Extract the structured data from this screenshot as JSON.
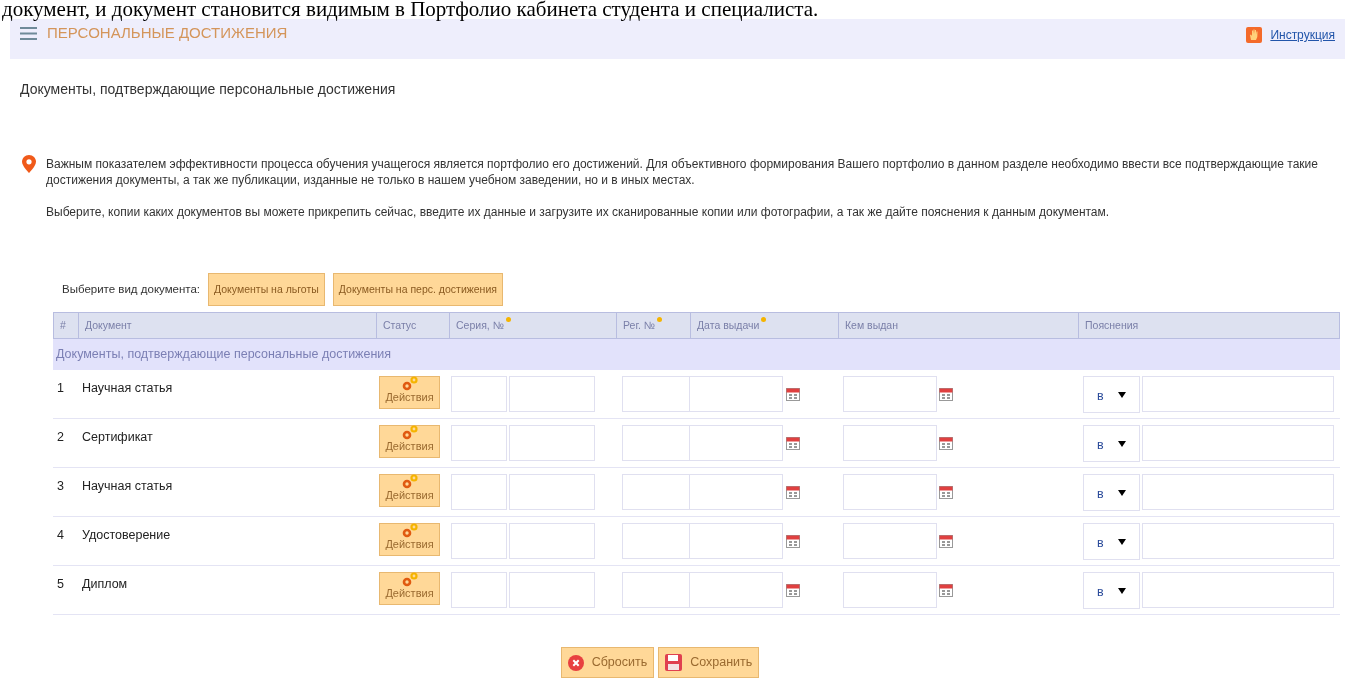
{
  "document_caption": "документ, и документ становится видимым в Портфолио кабинета студента и специалиста.",
  "header": {
    "title": "ПЕРСОНАЛЬНЫЕ ДОСТИЖЕНИЯ",
    "help_link": "Инструкция"
  },
  "page_title": "Документы, подтверждающие персональные достижения",
  "info": [
    "Важным показателем эффективности процесса обучения учащегося является портфолио его достижений. Для объективного формирования Вашего портфолио в данном разделе необходимо ввести все подтверждающие такие достижения документы, а так же публикации, изданные не только в нашем учебном заведении, но и в иных местах.",
    "Выберите, копии каких документов вы можете прикрепить сейчас, введите их данные и загрузите их сканированные копии или фотографии, а так же дайте пояснения к данным документам."
  ],
  "doc_type": {
    "label": "Выберите вид документа:",
    "buttons": [
      "Документы на льготы",
      "Документы на перс. достижения"
    ]
  },
  "table": {
    "columns": [
      {
        "label": "#",
        "required": false
      },
      {
        "label": "Документ",
        "required": false
      },
      {
        "label": "Статус",
        "required": false
      },
      {
        "label": "Серия, №",
        "required": true
      },
      {
        "label": "Рег. №",
        "required": true
      },
      {
        "label": "Дата выдачи",
        "required": true
      },
      {
        "label": "Кем выдан",
        "required": false
      },
      {
        "label": "Пояснения",
        "required": false
      }
    ],
    "group": "Документы, подтверждающие персональные достижения",
    "rows": [
      {
        "number": "1",
        "document": "Научная статья",
        "action": "Действия",
        "note_select": "в"
      },
      {
        "number": "2",
        "document": "Сертификат",
        "action": "Действия",
        "note_select": "в"
      },
      {
        "number": "3",
        "document": "Научная статья",
        "action": "Действия",
        "note_select": "в"
      },
      {
        "number": "4",
        "document": "Удостоверение",
        "action": "Действия",
        "note_select": "в"
      },
      {
        "number": "5",
        "document": "Диплом",
        "action": "Действия",
        "note_select": "в"
      }
    ]
  },
  "buttons": {
    "reset": "Сбросить",
    "save": "Сохранить"
  }
}
